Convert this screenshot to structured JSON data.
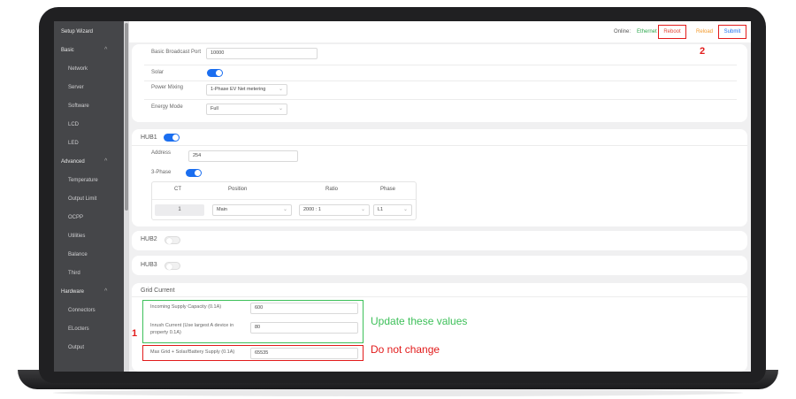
{
  "sidebar": {
    "items": [
      {
        "label": "Setup Wizard",
        "kind": "section",
        "chevron": false
      },
      {
        "label": "Basic",
        "kind": "section",
        "chevron": true
      },
      {
        "label": "Network",
        "kind": "sub"
      },
      {
        "label": "Server",
        "kind": "sub"
      },
      {
        "label": "Software",
        "kind": "sub"
      },
      {
        "label": "LCD",
        "kind": "sub"
      },
      {
        "label": "LED",
        "kind": "sub"
      },
      {
        "label": "Advanced",
        "kind": "section",
        "chevron": true
      },
      {
        "label": "Temperature",
        "kind": "sub"
      },
      {
        "label": "Output Limit",
        "kind": "sub"
      },
      {
        "label": "OCPP",
        "kind": "sub"
      },
      {
        "label": "Utilities",
        "kind": "sub"
      },
      {
        "label": "Balance",
        "kind": "sub"
      },
      {
        "label": "Third",
        "kind": "sub"
      },
      {
        "label": "Hardware",
        "kind": "section",
        "chevron": true
      },
      {
        "label": "Connectors",
        "kind": "sub"
      },
      {
        "label": "ELocters",
        "kind": "sub"
      },
      {
        "label": "Output",
        "kind": "sub"
      }
    ],
    "chevron_glyph": "^"
  },
  "header": {
    "status_label": "Online:",
    "status_value": "Ethernet",
    "reboot_label": "Reboot",
    "reload_label": "Reload",
    "submit_label": "Submit"
  },
  "basic": {
    "broadcast_port_label": "Basic Broadcast Port",
    "broadcast_port_value": "10000",
    "solar_label": "Solar",
    "solar_on": true,
    "power_mixing_label": "Power Mixing",
    "power_mixing_value": "1-Phase EV Net metering",
    "energy_mode_label": "Energy Mode",
    "energy_mode_value": "Full"
  },
  "hub1": {
    "title": "HUB1",
    "enabled": true,
    "address_label": "Address",
    "address_value": "254",
    "three_phase_label": "3-Phase",
    "three_phase_on": true,
    "table": {
      "headers": [
        "CT",
        "Position",
        "Ratio",
        "Phase"
      ],
      "rows": [
        {
          "ct": "1",
          "position": "Main",
          "ratio": "2000 : 1",
          "phase": "L1"
        }
      ]
    }
  },
  "hub2": {
    "title": "HUB2",
    "enabled": false
  },
  "hub3": {
    "title": "HUB3",
    "enabled": false
  },
  "grid": {
    "title": "Grid Current",
    "incoming_label": "Incoming Supply Capacity (0.1A)",
    "incoming_value": "600",
    "inrush_label_1": "Inrush Current (Use largest A device in",
    "inrush_label_2": "property 0.1A)",
    "inrush_value": "80",
    "max_label": "Max Grid + Solar/Battery Supply (0.1A)",
    "max_value": "65535"
  },
  "annotations": {
    "green_text": "Update these values",
    "red_text": "Do not change",
    "num_1": "1",
    "num_2": "2"
  },
  "colors": {
    "accent_blue": "#1a6ef0",
    "annotation_green": "#3ec05a",
    "annotation_red": "#e21b1b",
    "status_green": "#2fa84f",
    "reboot_red": "#e24a3b",
    "reload_orange": "#f39a2c",
    "submit_blue": "#1a6ef0",
    "sidebar_bg": "#454649"
  },
  "icons": {
    "select_chevron": "chevron-down-icon"
  }
}
